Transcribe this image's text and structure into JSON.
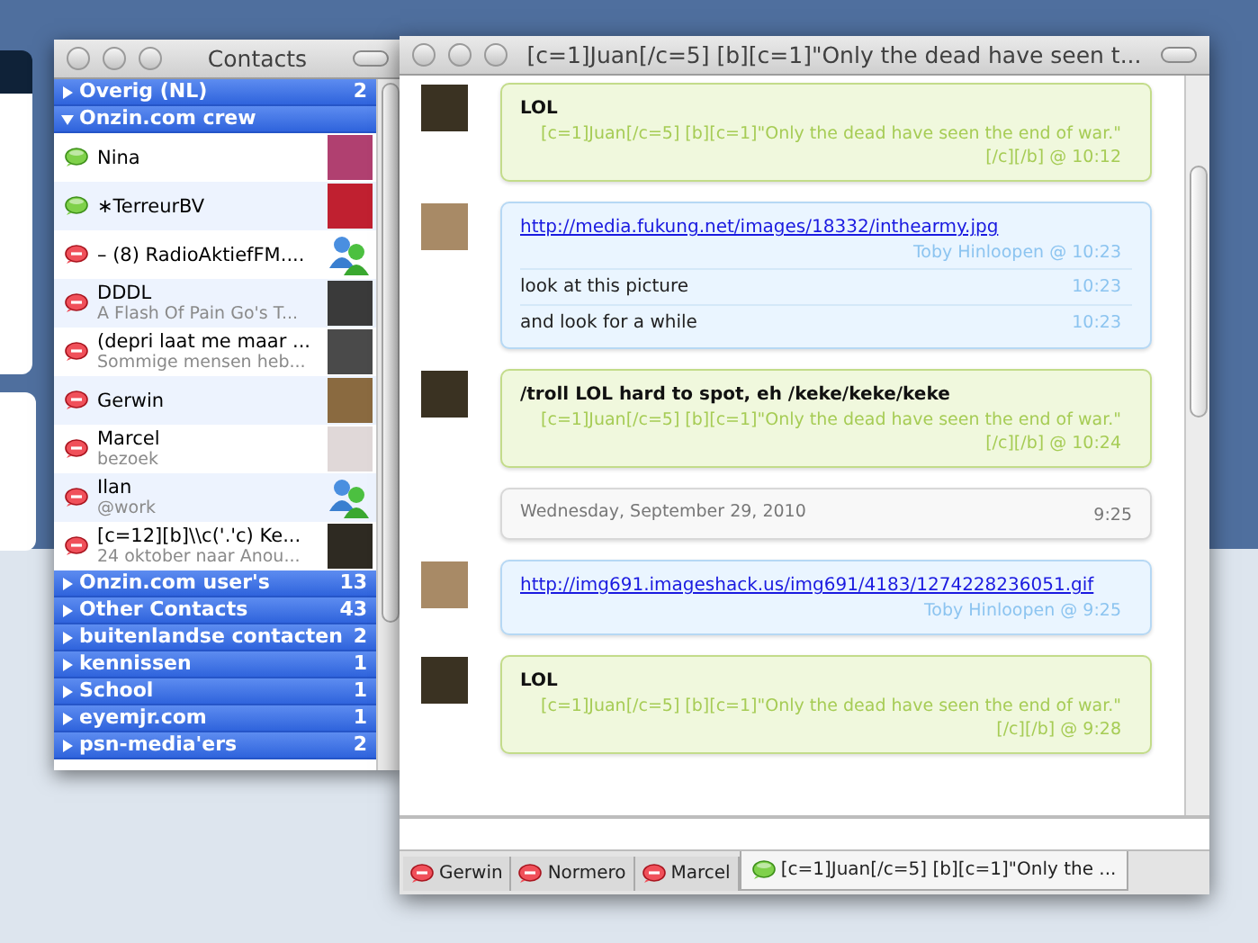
{
  "contacts_window": {
    "title": "Contacts",
    "groups_before": [
      {
        "label": "Overig (NL)",
        "count": "2",
        "expanded": false
      },
      {
        "label": "Onzin.com crew",
        "expanded": true
      }
    ],
    "contacts": [
      {
        "name": "Nina",
        "color": "#7fd14a",
        "kind": "photo"
      },
      {
        "name": "∗TerreurBV",
        "color": "#7fd14a",
        "kind": "photo"
      },
      {
        "name": "– (8) RadioAktiefFM....",
        "color": "#f0505a",
        "kind": "buddy"
      },
      {
        "name": "DDDL",
        "message": "A Flash Of Pain Go's T...",
        "color": "#f0505a",
        "kind": "photo"
      },
      {
        "name": "(depri laat me maar ...",
        "message": "Sommige mensen heb...",
        "color": "#f0505a",
        "kind": "photo"
      },
      {
        "name": "Gerwin",
        "color": "#f0505a",
        "kind": "photo"
      },
      {
        "name": "Marcel",
        "message": "bezoek",
        "color": "#f0505a",
        "kind": "photo"
      },
      {
        "name": "Ilan",
        "message": "@work",
        "color": "#f0505a",
        "kind": "buddy"
      },
      {
        "name": "[c=12][b]\\\\c('.'c) Ke...",
        "message": "24 oktober naar Anou...",
        "color": "#f0505a",
        "kind": "photo"
      }
    ],
    "groups_after": [
      {
        "label": "Onzin.com user's",
        "count": "13",
        "expanded": false
      },
      {
        "label": "Other Contacts",
        "count": "43",
        "expanded": false
      },
      {
        "label": "buitenlandse contacten",
        "count": "2",
        "expanded": false
      },
      {
        "label": "kennissen",
        "count": "1",
        "expanded": false
      },
      {
        "label": "School",
        "count": "1",
        "expanded": false
      },
      {
        "label": "eyemjr.com",
        "count": "1",
        "expanded": false
      },
      {
        "label": "psn-media'ers",
        "count": "2",
        "expanded": false
      }
    ]
  },
  "chat_window": {
    "title": "[c=1]Juan[/c=5] [b][c=1]\"Only the dead have seen t...",
    "messages": [
      {
        "kind": "received",
        "parts": [
          {
            "text": "LOL",
            "meta": "[c=1]Juan[/c=5] [b][c=1]\"Only the dead have seen the end of war.\"[/c][/b] @ 10:12"
          }
        ]
      },
      {
        "kind": "sent",
        "parts": [
          {
            "text": "http://media.fukung.net/images/18332/inthearmy.jpg",
            "link": true,
            "meta": "Toby Hinloopen @ 10:23"
          },
          {
            "text": "look at this picture",
            "meta": "10:23"
          },
          {
            "text": "and look for a while",
            "meta": "10:23"
          }
        ]
      },
      {
        "kind": "received",
        "parts": [
          {
            "text": "/troll LOL hard to spot, eh /keke/keke/keke",
            "meta": "[c=1]Juan[/c=5] [b][c=1]\"Only the dead have seen the end of war.\"[/c][/b] @ 10:24"
          }
        ]
      },
      {
        "kind": "date",
        "text": "Wednesday, September 29, 2010",
        "meta": "9:25"
      },
      {
        "kind": "sent",
        "parts": [
          {
            "text": "http://img691.imageshack.us/img691/4183/1274228236051.gif",
            "link": true,
            "meta": "Toby Hinloopen @ 9:25"
          }
        ]
      },
      {
        "kind": "received",
        "parts": [
          {
            "text": "LOL",
            "meta": "[c=1]Juan[/c=5] [b][c=1]\"Only the dead have seen the end of war.\"[/c][/b] @ 9:28"
          }
        ]
      }
    ],
    "tabs": [
      {
        "label": "Gerwin",
        "color": "#f0505a",
        "selected": false
      },
      {
        "label": "Normero",
        "color": "#f0505a",
        "selected": false
      },
      {
        "label": "Marcel",
        "color": "#f0505a",
        "selected": false
      },
      {
        "label": "[c=1]Juan[/c=5] [b][c=1]\"Only the ...",
        "color": "#7fd14a",
        "selected": true
      }
    ]
  }
}
